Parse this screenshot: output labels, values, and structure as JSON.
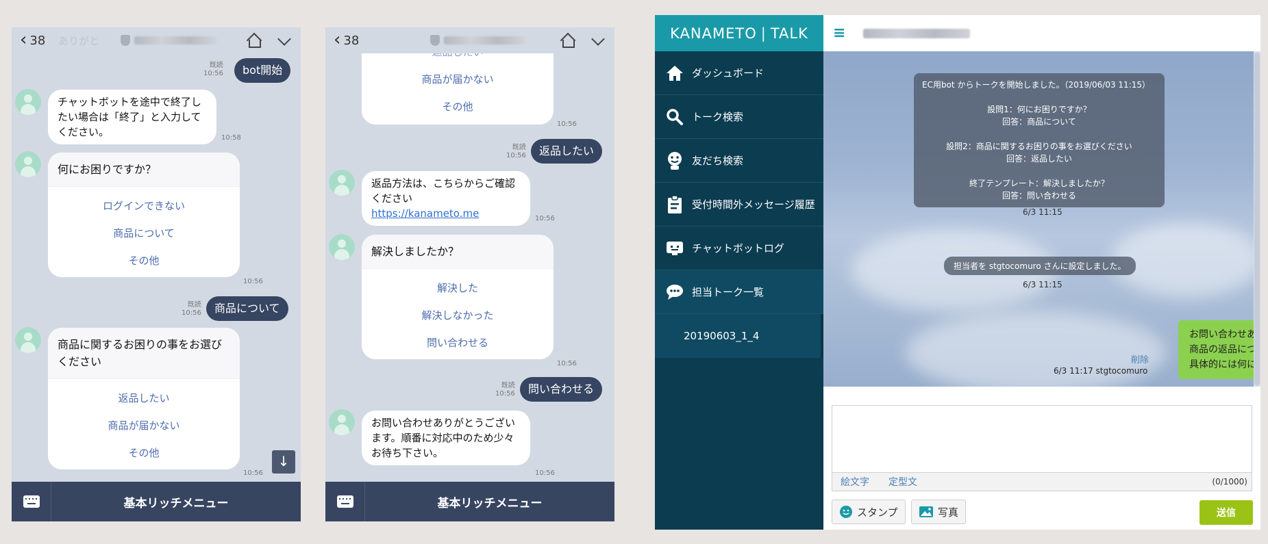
{
  "phone1": {
    "header": {
      "back_count": "38",
      "faded_text": "ありがと"
    },
    "messages": {
      "m1_read": "既読",
      "m1_time": "10:56",
      "m1_text": "bot開始",
      "m2_text": "チャットボットを途中で終了したい場合は「終了」と入力してください。",
      "m2_time": "10:58",
      "card1_title": "何にお困りですか？",
      "card1_options": [
        "ログインできない",
        "商品について",
        "その他"
      ],
      "card1_time": "10:56",
      "m3_read": "既読",
      "m3_time": "10:56",
      "m3_text": "商品について",
      "card2_title": "商品に関するお困りの事をお選びください",
      "card2_options": [
        "返品したい",
        "商品が届かない",
        "その他"
      ],
      "card2_time": "10:56"
    },
    "footer_label": "基本リッチメニュー"
  },
  "phone2": {
    "header": {
      "back_count": "38"
    },
    "messages": {
      "card0_options": [
        "返品したい",
        "商品が届かない",
        "その他"
      ],
      "card0_time": "10:56",
      "m1_read": "既読",
      "m1_time": "10:56",
      "m1_text": "返品したい",
      "m2_text": "返品方法は、こちらからご確認ください",
      "m2_link": "https://kanameto.me",
      "m2_time": "10:56",
      "card1_title": "解決しましたか？",
      "card1_options": [
        "解決した",
        "解決しなかった",
        "問い合わせる"
      ],
      "card1_time": "10:56",
      "m3_read": "既読",
      "m3_time": "10:56",
      "m3_text": "問い合わせる",
      "m4_text": "お問い合わせありがとうございます。順番に対応中のため少々お待ち下さい。",
      "m4_time": "10:56"
    },
    "footer_label": "基本リッチメニュー"
  },
  "app": {
    "logo_left": "KANAMETO",
    "logo_right": "TALK",
    "nav": [
      {
        "label": "ダッシュボード",
        "icon": "home-icon"
      },
      {
        "label": "トーク検索",
        "icon": "search-icon"
      },
      {
        "label": "友だち検索",
        "icon": "smiley-icon"
      },
      {
        "label": "受付時間外メッセージ履歴",
        "icon": "clipboard-icon"
      },
      {
        "label": "チャットボットログ",
        "icon": "bot-icon"
      },
      {
        "label": "担当トーク一覧",
        "icon": "chat-bubble-icon"
      }
    ],
    "sub_item": "20190603_1_4",
    "system_card": {
      "line1": "EC用bot からトークを開始しました。（2019/06/03 11:15）",
      "q1": "設問1：何にお困りですか？",
      "a1": "回答：商品について",
      "q2": "設問2：商品に関するお困りの事をお選びください",
      "a2": "回答：返品したい",
      "q3": "終了テンプレート：解決しましたか？",
      "a3": "回答：問い合わせる",
      "time": "6/3 11:15"
    },
    "assign_notice": "担当者を stgtocomuro さんに設定しました。",
    "assign_time": "6/3 11:15",
    "reply": {
      "line1": "お問い合わせありがとうございます。",
      "line2": "商品の返品についてお困りとのことですが、",
      "line3": "具体的には何にお困りでしょうか？",
      "delete_label": "削除",
      "sent_info": "6/3 11:17 stgtocomuro"
    },
    "composer": {
      "emoji_label": "絵文字",
      "template_label": "定型文",
      "count": "(0/1000)",
      "stamp_label": "スタンプ",
      "photo_label": "写真",
      "send_label": "送信"
    },
    "colors": {
      "brand": "#1a9aa8",
      "sidebar": "#0c3c50",
      "send": "#9bc315",
      "reply_bubble": "#8bd14f"
    }
  }
}
